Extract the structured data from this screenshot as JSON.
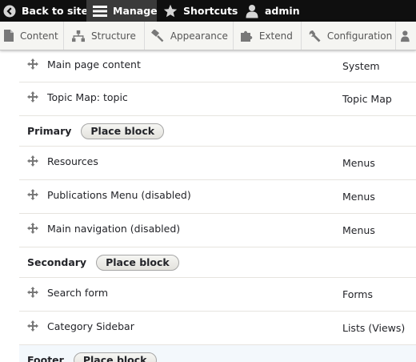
{
  "toolbar": {
    "back": "Back to site",
    "manage": "Manage",
    "shortcuts": "Shortcuts",
    "user": "admin"
  },
  "tray": {
    "content": "Content",
    "structure": "Structure",
    "appearance": "Appearance",
    "extend": "Extend",
    "configuration": "Configuration"
  },
  "blocks": {
    "rows_top": [
      {
        "name": "Main page content",
        "category": "System"
      },
      {
        "name": "Topic Map: topic",
        "category": "Topic Map"
      }
    ],
    "primary": {
      "title": "Primary",
      "button": "Place block",
      "rows": [
        {
          "name": "Resources",
          "category": "Menus"
        },
        {
          "name": "Publications Menu (disabled)",
          "category": "Menus"
        },
        {
          "name": "Main navigation (disabled)",
          "category": "Menus"
        }
      ]
    },
    "secondary": {
      "title": "Secondary",
      "button": "Place block",
      "rows": [
        {
          "name": "Search form",
          "category": "Forms"
        },
        {
          "name": "Category Sidebar",
          "category": "Lists (Views)"
        }
      ]
    },
    "footer": {
      "title": "Footer",
      "button": "Place block"
    }
  },
  "colors": {
    "toolbar_bg": "#0f0f0f",
    "toolbar_active": "#3a3a3a",
    "tray_bg": "#f5f5f2",
    "footer_highlight": "#f3f8fc"
  }
}
